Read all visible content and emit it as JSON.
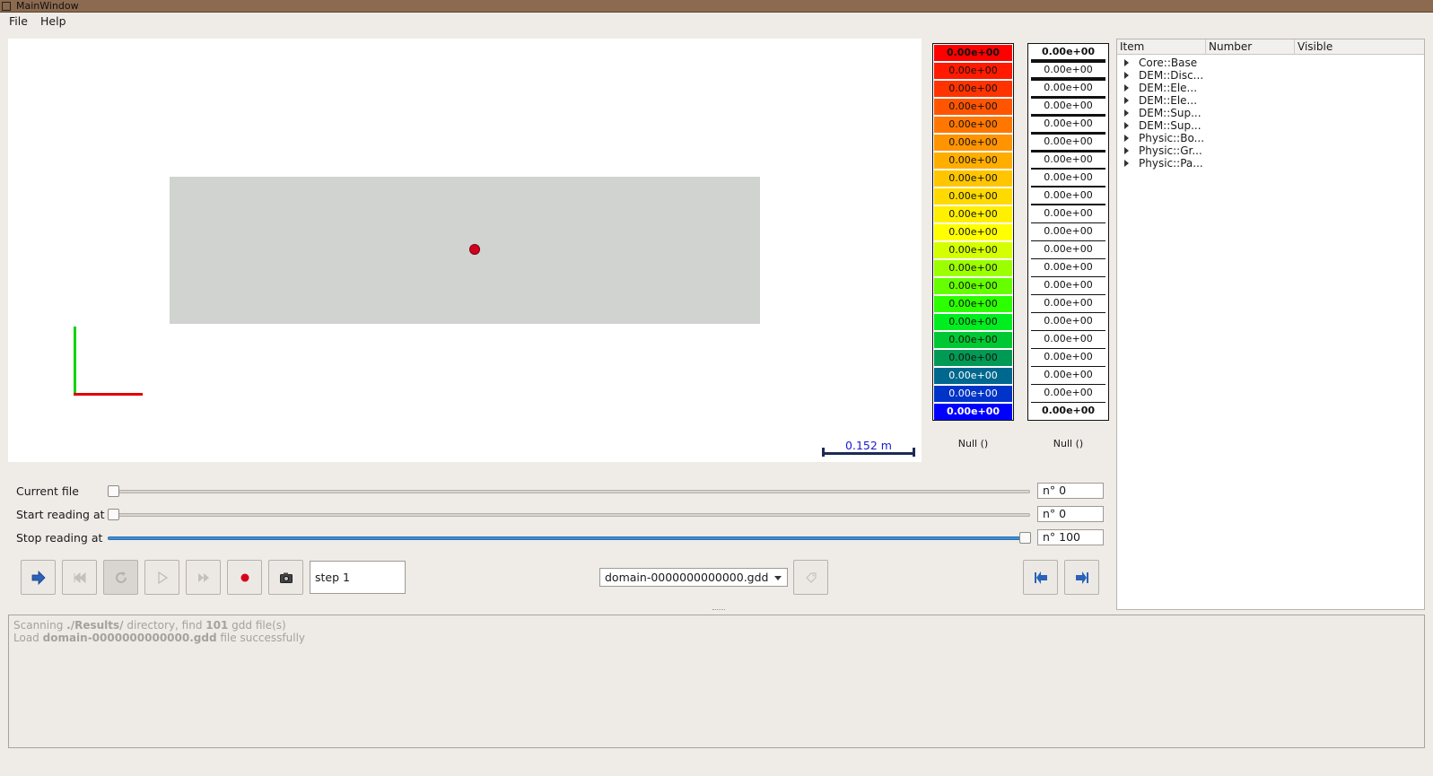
{
  "window": {
    "title": "MainWindow"
  },
  "menu": {
    "file": "File",
    "help": "Help"
  },
  "viewport": {
    "scale_label": "0.152 m"
  },
  "legend_color": {
    "values": [
      "0.00e+00",
      "0.00e+00",
      "0.00e+00",
      "0.00e+00",
      "0.00e+00",
      "0.00e+00",
      "0.00e+00",
      "0.00e+00",
      "0.00e+00",
      "0.00e+00",
      "0.00e+00",
      "0.00e+00",
      "0.00e+00",
      "0.00e+00",
      "0.00e+00",
      "0.00e+00",
      "0.00e+00",
      "0.00e+00",
      "0.00e+00",
      "0.00e+00",
      "0.00e+00"
    ],
    "colors": [
      "#ff0000",
      "#ff1a00",
      "#ff3300",
      "#ff5500",
      "#ff7700",
      "#ff9400",
      "#ffae00",
      "#ffc600",
      "#ffda00",
      "#ffef00",
      "#ffff00",
      "#d4ff00",
      "#9cff00",
      "#66ff00",
      "#2bff00",
      "#00ee20",
      "#00c832",
      "#009a55",
      "#00678e",
      "#0033c8",
      "#0000ff"
    ],
    "label": "Null ()"
  },
  "legend_bw": {
    "values": [
      "0.00e+00",
      "0.00e+00",
      "0.00e+00",
      "0.00e+00",
      "0.00e+00",
      "0.00e+00",
      "0.00e+00",
      "0.00e+00",
      "0.00e+00",
      "0.00e+00",
      "0.00e+00",
      "0.00e+00",
      "0.00e+00",
      "0.00e+00",
      "0.00e+00",
      "0.00e+00",
      "0.00e+00",
      "0.00e+00",
      "0.00e+00",
      "0.00e+00",
      "0.00e+00"
    ],
    "label": "Null ()"
  },
  "tree": {
    "columns": [
      "Item",
      "Number",
      "Visible"
    ],
    "items": [
      "Core::Base",
      "DEM::Disc...",
      "DEM::Ele...",
      "DEM::Ele...",
      "DEM::Sup...",
      "DEM::Sup...",
      "Physic::Bo...",
      "Physic::Gr...",
      "Physic::Pa..."
    ]
  },
  "sliders": {
    "current_file": {
      "label": "Current file",
      "value": "n° 0",
      "position": 0
    },
    "start_reading": {
      "label": "Start reading at",
      "value": "n° 0",
      "position": 0
    },
    "stop_reading": {
      "label": "Stop reading at",
      "value": "n° 100",
      "position": 1
    }
  },
  "toolbar": {
    "icons": [
      "arrow-right-icon",
      "skip-first-icon",
      "reload-icon",
      "play-icon",
      "skip-last-icon",
      "record-icon",
      "camera-icon"
    ],
    "step_value": "step 1",
    "file_combo": "domain-0000000000000.gdd",
    "nav_icons": [
      "first-file-icon",
      "last-file-icon"
    ]
  },
  "log": {
    "line1": {
      "pre": "Scanning ",
      "dir": "./Results/",
      "mid": " directory, find ",
      "count": "101",
      "post": " gdd file(s)"
    },
    "line2": {
      "pre": "Load ",
      "file": "domain-0000000000000.gdd",
      "post": " file successfully"
    }
  }
}
